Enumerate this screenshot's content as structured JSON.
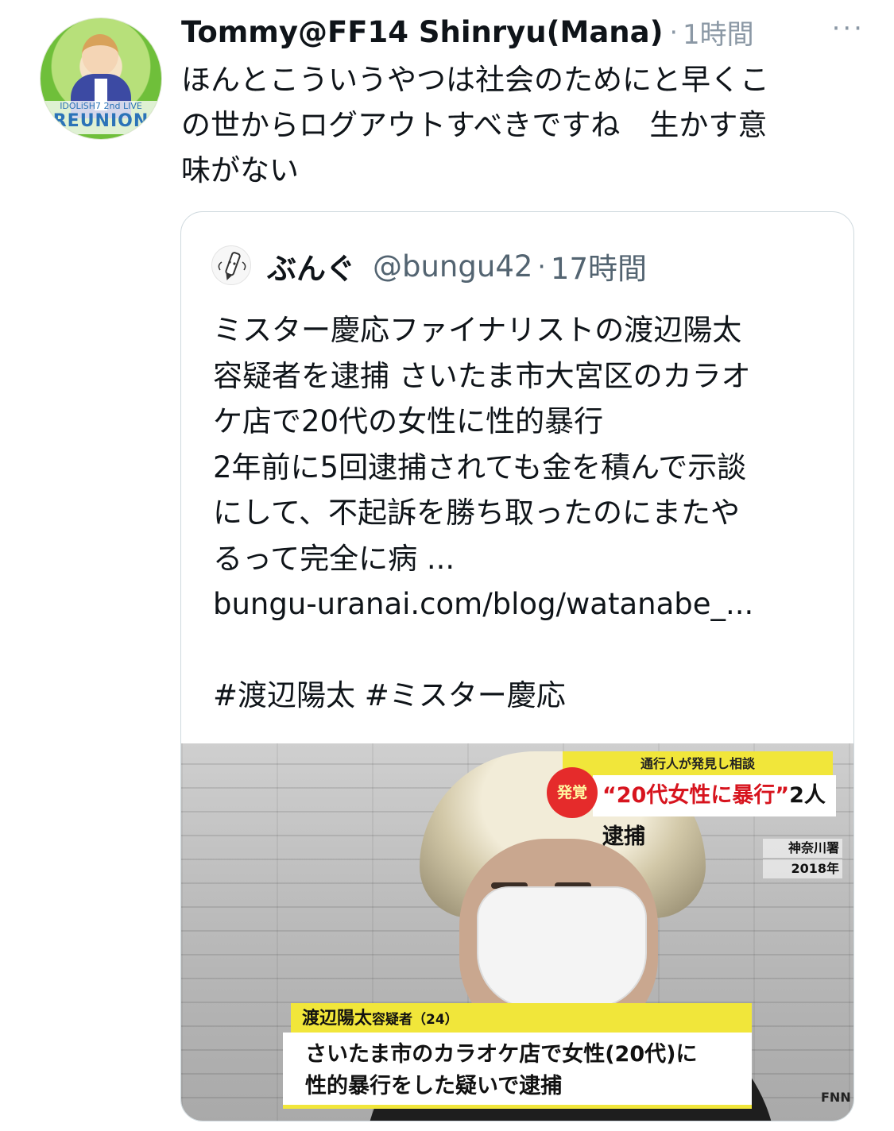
{
  "tweet": {
    "author": "Tommy@FF14 Shinryu(Mana)",
    "dot": "·",
    "time": "1時間",
    "more": "···",
    "text": "ほんとこういうやつは社会のためにと早くこ\nの世からログアウトすべきですね　生かす意\n味がない",
    "avatar_text_top": "IDOLiSH7 2nd LIVE",
    "avatar_text_big": "REUNION"
  },
  "quote": {
    "name": "ぶんぐ",
    "handle": "@bungu42",
    "dot": "·",
    "time": "17時間",
    "text": "ミスター慶応ファイナリストの渡辺陽太\n容疑者を逮捕 さいたま市大宮区のカラオ\nケ店で20代の女性に性的暴行\n2年前に5回逮捕されても金を積んで示談\nにして、不起訴を勝ち取ったのにまたや\nるって完全に病 ...\nbungu-uranai.com/blog/watanabe_...\n\n#渡辺陽太 #ミスター慶応"
  },
  "media": {
    "caption_top": "通行人が発見し相談",
    "caption_burst": "発覚",
    "caption_main_red": "“20代女性に暴行”",
    "caption_main_black": "2人逮捕",
    "station": "神奈川署",
    "year": "2018年",
    "name_line": "渡辺陽太",
    "name_suffix": "容疑者（24）",
    "desc": "さいたま市のカラオケ店で女性(20代)に\n性的暴行をした疑いで逮捕",
    "corner": "FNN"
  },
  "colors": {
    "text": "#0f1419",
    "secondary": "#536471",
    "border": "#cfd9de",
    "caption_yellow": "#f1e63a",
    "caption_red": "#d7141e"
  }
}
